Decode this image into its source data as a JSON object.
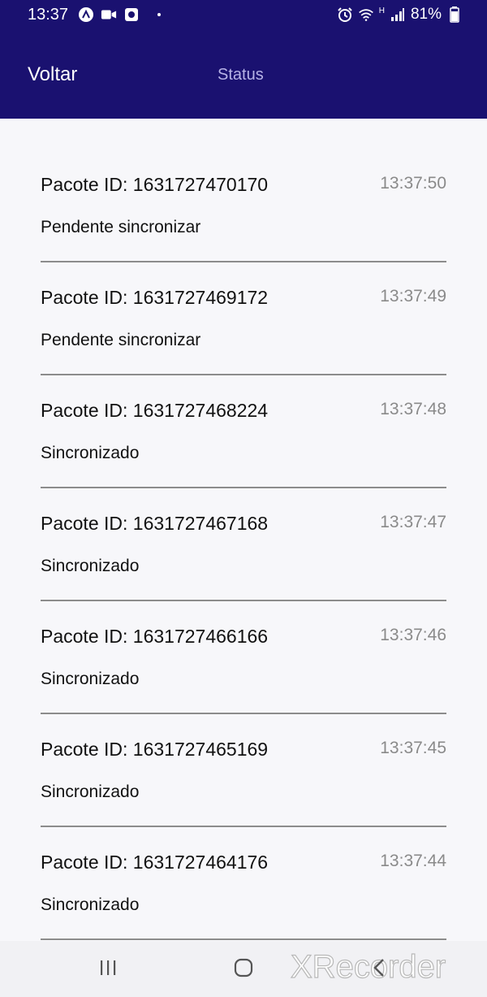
{
  "status_bar": {
    "time": "13:37",
    "battery": "81%",
    "network_label": "H"
  },
  "header": {
    "back_label": "Voltar",
    "title": "Status"
  },
  "packages": [
    {
      "id_label": "Pacote ID: 1631727470170",
      "time": "13:37:50",
      "status": "Pendente sincronizar"
    },
    {
      "id_label": "Pacote ID: 1631727469172",
      "time": "13:37:49",
      "status": "Pendente sincronizar"
    },
    {
      "id_label": "Pacote ID: 1631727468224",
      "time": "13:37:48",
      "status": "Sincronizado"
    },
    {
      "id_label": "Pacote ID: 1631727467168",
      "time": "13:37:47",
      "status": "Sincronizado"
    },
    {
      "id_label": "Pacote ID: 1631727466166",
      "time": "13:37:46",
      "status": "Sincronizado"
    },
    {
      "id_label": "Pacote ID: 1631727465169",
      "time": "13:37:45",
      "status": "Sincronizado"
    },
    {
      "id_label": "Pacote ID: 1631727464176",
      "time": "13:37:44",
      "status": "Sincronizado"
    }
  ],
  "watermark": "XRecorder",
  "colors": {
    "header_bg": "#1a1170",
    "title_color": "#b7b3e6",
    "time_color": "#8a8a8a"
  }
}
